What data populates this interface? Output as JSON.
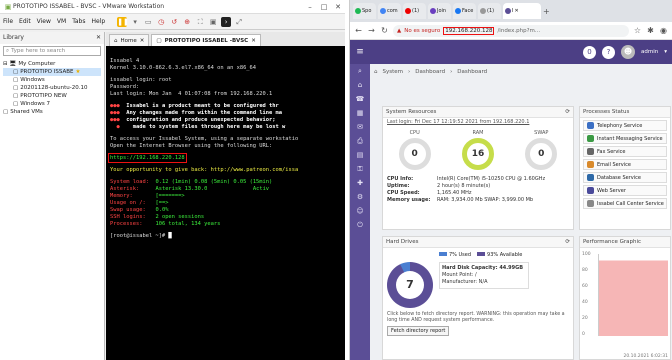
{
  "vmware": {
    "title": "PROTOTIPO ISSABEL - BVSC - VMware Workstation",
    "menu": [
      "File",
      "Edit",
      "View",
      "VM",
      "Tabs",
      "Help"
    ],
    "library": {
      "header": "Library",
      "search_placeholder": "Type here to search",
      "items": [
        "My Computer",
        "PROTOTIPO ISSABE",
        "Windows",
        "20201128-ubuntu-20.10",
        "PROTOTIPO NEW",
        "Windows 7",
        "Shared VMs"
      ]
    },
    "tabs": [
      "Home",
      "PROTOTIPO ISSABEL -BVSC"
    ],
    "terminal": {
      "line1": "Issabel 4",
      "line2": "Kernel 3.10.0-862.6.3.el7.x86_64 on an x86_64",
      "login1": "issabel login: root",
      "password": "Password:",
      "lastlogin": "Last login: Mon Jan  4 01:07:08 from 192.168.220.1",
      "logo1": "●●●",
      "logo2": "●●●",
      "logo3": "●●●",
      "logo4": "  ●",
      "msg1": "Issabel is a product meant to be configured thr",
      "msg2": "Any changes made from within the command line ma",
      "msg3": "configuration and produce unexpected behavior;",
      "msg4": "made to system files through here may be lost w",
      "access1": "To access your Issabel System, using a separate workstatio",
      "access2": "Open the Internet Browser using the following URL:",
      "url": "https://192.168.220.128",
      "promo": "Your opportunity to give back: http://www.patreon.com/issa",
      "load_k": "System load:",
      "load_v": "0.12 (1min) 0.08 (5min) 0.05 (15min)",
      "ast_k": "Asterisk:",
      "ast_v": "Asterisk 13.30.0",
      "ast_s": "Activ",
      "mem_k": "Memory:",
      "mem_v": "[=======>",
      "root_k": "Usage on /:",
      "root_v": "[==>",
      "swap_k": "Swap usage:",
      "swap_v": "0.0%",
      "ssh_k": "SSH logins:",
      "ssh_v": "2 open sessions",
      "proc_k": "Processes:",
      "proc_v": "106 total, 134 years",
      "prompt": "[root@issabel ~]# "
    }
  },
  "browser": {
    "tabs": [
      "Spo",
      "com",
      "(1)",
      "Join",
      "Face",
      "(1)"
    ],
    "active_tab": "I",
    "address": {
      "warning": "No es seguro",
      "ip": "192.168.220.128",
      "path": "/index.php?m..."
    },
    "topbar": {
      "notif_count": "0",
      "user": "admin"
    },
    "breadcrumbs": [
      "System",
      "Dashboard",
      "Dashboard"
    ],
    "resources": {
      "title": "System Resources",
      "lastlogin": "Last login: Fri Dec 17 12:19:52 2021 from 192.168.220.1",
      "gauges": [
        {
          "label": "CPU",
          "value": "0"
        },
        {
          "label": "RAM",
          "value": "16"
        },
        {
          "label": "SWAP",
          "value": "0"
        }
      ],
      "info": [
        {
          "k": "CPU Info:",
          "v": "Intel(R) Core(TM) i5-10250 CPU @ 1.60GHz"
        },
        {
          "k": "Uptime:",
          "v": "2 hour(s) 8 minute(s)"
        },
        {
          "k": "CPU Speed:",
          "v": "1,165.40 MHz"
        },
        {
          "k": "Memory usage:",
          "v": "RAM: 3,934.00 Mb SWAP: 3,999.00 Mb"
        }
      ]
    },
    "process_status": {
      "title": "Processes Status",
      "services": [
        {
          "name": "Telephony Service",
          "color": "#3b6fc4"
        },
        {
          "name": "Instant Messaging Service",
          "color": "#3b9a44"
        },
        {
          "name": "Fax Service",
          "color": "#666666"
        },
        {
          "name": "Email Service",
          "color": "#d98a2c"
        },
        {
          "name": "Database Service",
          "color": "#2f6aa8"
        },
        {
          "name": "Web Server",
          "color": "#4a4a9a"
        },
        {
          "name": "Issabel Call Center Service",
          "color": "#888888"
        }
      ]
    },
    "harddrives": {
      "title": "Hard Drives",
      "used_label": "7% Used",
      "avail_label": "93% Available",
      "center": "7",
      "capacity": "Hard Disk Capacity: 44.99GB",
      "mount": "Mount Point: /",
      "manufacturer": "Manufacturer: N/A",
      "note": "Click below to fetch directory report. WARNING: this operation may take a long time AND request system performance.",
      "button": "Fetch directory report",
      "colors": {
        "used": "#4a7fd1",
        "available": "#5b4e96"
      }
    },
    "performance": {
      "title": "Performance Graphic",
      "ticks": [
        "100",
        "80",
        "60",
        "40",
        "20",
        "0"
      ],
      "date": "20.10.2021 6:02:31"
    }
  }
}
